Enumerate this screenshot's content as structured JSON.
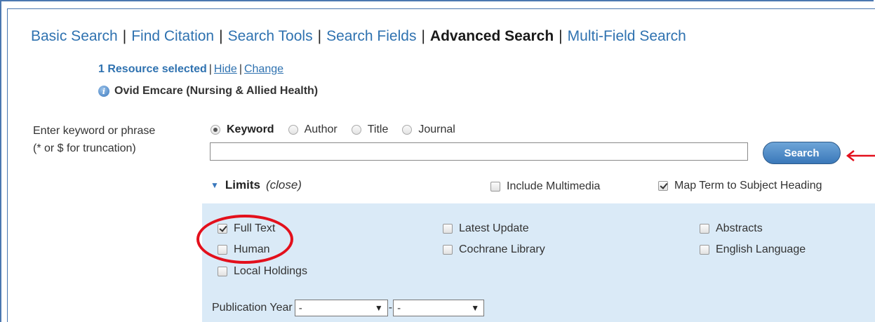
{
  "nav": {
    "tabs": [
      {
        "label": "Basic Search"
      },
      {
        "label": "Find Citation"
      },
      {
        "label": "Search Tools"
      },
      {
        "label": "Search Fields"
      },
      {
        "label": "Advanced Search"
      },
      {
        "label": "Multi-Field Search"
      }
    ],
    "separator": "|",
    "active_tab": "Advanced Search"
  },
  "resource": {
    "selected_text": "1 Resource selected",
    "separator": "|",
    "hide_link": "Hide",
    "change_link": "Change",
    "info_icon_glyph": "i",
    "database_name": "Ovid Emcare (Nursing & Allied Health)"
  },
  "search": {
    "prompt_line1": "Enter keyword or phrase",
    "prompt_line2": "(* or $ for truncation)",
    "modes": [
      {
        "label": "Keyword",
        "selected": true
      },
      {
        "label": "Author",
        "selected": false
      },
      {
        "label": "Title",
        "selected": false
      },
      {
        "label": "Journal",
        "selected": false
      }
    ],
    "input_value": "",
    "button_label": "Search"
  },
  "limits": {
    "toggle_glyph": "▼",
    "label": "Limits",
    "close_label": "(close)",
    "include_multimedia": {
      "label": "Include Multimedia",
      "checked": false
    },
    "map_term": {
      "label": "Map Term to Subject Heading",
      "checked": true
    },
    "options": [
      {
        "label": "Full Text",
        "checked": true
      },
      {
        "label": "Latest Update",
        "checked": false
      },
      {
        "label": "Abstracts",
        "checked": false
      },
      {
        "label": "Human",
        "checked": false
      },
      {
        "label": "Cochrane Library",
        "checked": false
      },
      {
        "label": "English Language",
        "checked": false
      },
      {
        "label": "Local Holdings",
        "checked": false
      }
    ],
    "publication_year": {
      "label": "Publication Year",
      "from_value": "-",
      "to_value": "-",
      "range_separator": "-",
      "caret_glyph": "▼"
    }
  },
  "annotations": {
    "highlight_color": "#e3101c"
  },
  "colors": {
    "link_blue": "#2f72b0",
    "panel_bg": "#daeaf7",
    "button_blue": "#3a78b9"
  }
}
